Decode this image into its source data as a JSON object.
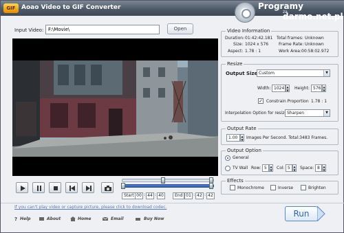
{
  "window": {
    "icon_text": "GIF",
    "title": "Aoao Video to GIF Converter",
    "watermark_line1": "Programy",
    "watermark_za": "za",
    "watermark_line2": "darmo.net.pl"
  },
  "input": {
    "label": "Input Video:",
    "value": "F:\\Movie\\",
    "open_label": "Open"
  },
  "video_information": {
    "title": "Video Information",
    "duration_label": "Duration:",
    "duration": "01:42:42.181",
    "size_label": "Size:",
    "size": "1024 x 576",
    "aspect_label": "Aspect:",
    "aspect": "1.78 : 1",
    "total_frames_label": "Total frames:",
    "total_frames": "Unknown",
    "frame_rate_label": "Frame Rate:",
    "frame_rate": "Unknown",
    "work_area_label": "Work Area:",
    "work_area": "00:58:02.972"
  },
  "resize": {
    "title": "Resize",
    "output_size_label": "Output Size:",
    "output_size": "Custom",
    "width_label": "Width:",
    "width": "1024",
    "height_label": "Height:",
    "height": "576",
    "constrain_label": "Constrain Proportion",
    "constrain_checked": true,
    "ratio": "1.78 : 1",
    "interp_label": "Interpolation Option for resize:",
    "interp_value": "Sharpen"
  },
  "output_rate": {
    "title": "Output Rate",
    "value": "1.00",
    "desc": "Images Per Second. Total:3483 Frames."
  },
  "output_option": {
    "title": "Output Option",
    "general_label": "General",
    "general_selected": true,
    "tvwall_label": "TV Wall",
    "row_label": "Row:",
    "row": "5",
    "col_label": "Col:",
    "col": "5",
    "space_label": "Space:",
    "space": "8"
  },
  "effects": {
    "title": "Effects",
    "monochrome": "Monochrome",
    "inverse": "Inverse",
    "brighten": "Brighten"
  },
  "timeline": {
    "start_label": "Start",
    "start": [
      "00",
      "44",
      "40"
    ],
    "end_label": "End",
    "end": [
      "01",
      "42",
      "42"
    ],
    "position_fraction": 0.44
  },
  "footer": {
    "codec_link": "If you can't play video or capture picture, please click to download codec.",
    "help": "Help",
    "about": "About",
    "home": "Home",
    "email": "Email",
    "buy_now": "Buy Now",
    "run_label": "Run"
  }
}
